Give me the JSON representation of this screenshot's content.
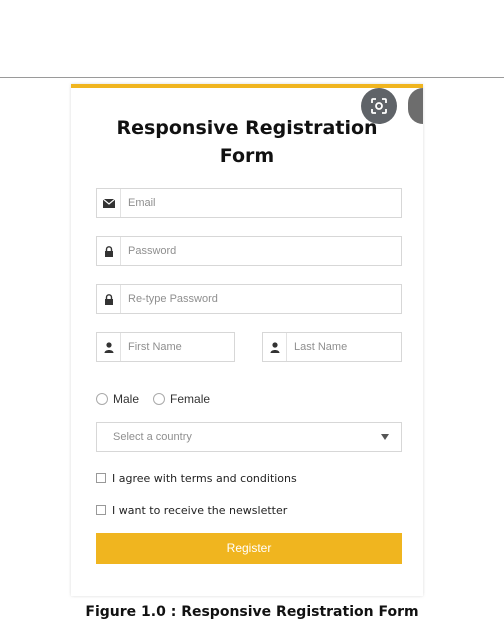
{
  "form": {
    "title_line1": "Responsive Registration",
    "title_line2": "Form",
    "email_placeholder": "Email",
    "password_placeholder": "Password",
    "retype_password_placeholder": "Re-type Password",
    "first_name_placeholder": "First Name",
    "last_name_placeholder": "Last Name",
    "gender_male_label": "Male",
    "gender_female_label": "Female",
    "country_placeholder": "Select a country",
    "agree_terms_label": "I agree with terms and conditions",
    "newsletter_label": "I want to receive the newsletter",
    "register_label": "Register"
  },
  "icons": {
    "email": "envelope-icon",
    "password": "lock-icon",
    "retype_password": "lock-icon",
    "first_name": "user-icon",
    "last_name": "user-icon",
    "lens": "google-lens-icon",
    "select": "caret-down-icon"
  },
  "colors": {
    "accent": "#f0b51f",
    "placeholder": "#8f8f8f",
    "border": "#d7d7d7"
  },
  "caption": "Figure 1.0  : Responsive Registration Form"
}
